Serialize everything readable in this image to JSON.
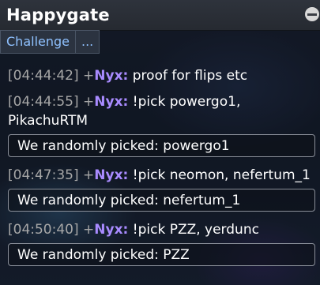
{
  "window": {
    "title": "Happygate",
    "minimize_icon": "minimize-circle-icon"
  },
  "tabs": [
    {
      "label": "Challenge"
    },
    {
      "label": "..."
    }
  ],
  "log": {
    "m1": {
      "time": "[04:44:42]",
      "plus": "+",
      "user": "Nyx:",
      "text": "proof for flips etc"
    },
    "m2": {
      "time": "[04:44:55]",
      "plus": "+",
      "user": "Nyx:",
      "text": "!pick powergo1, PikachuRTM"
    },
    "n1": {
      "text": "We randomly picked:  powergo1"
    },
    "m3": {
      "time": "[04:47:35]",
      "plus": "+",
      "user": "Nyx:",
      "text": "!pick neomon, nefertum_1"
    },
    "n2": {
      "text": "We randomly picked:  nefertum_1"
    },
    "m4": {
      "time": "[04:50:40]",
      "plus": "+",
      "user": "Nyx:",
      "text": "!pick PZZ, yerdunc"
    },
    "n3": {
      "text": "We randomly picked:  PZZ"
    }
  },
  "colors": {
    "username": "#a98bff",
    "timestamp": "#a7a7a7",
    "tab_text": "#8fc1ff"
  }
}
